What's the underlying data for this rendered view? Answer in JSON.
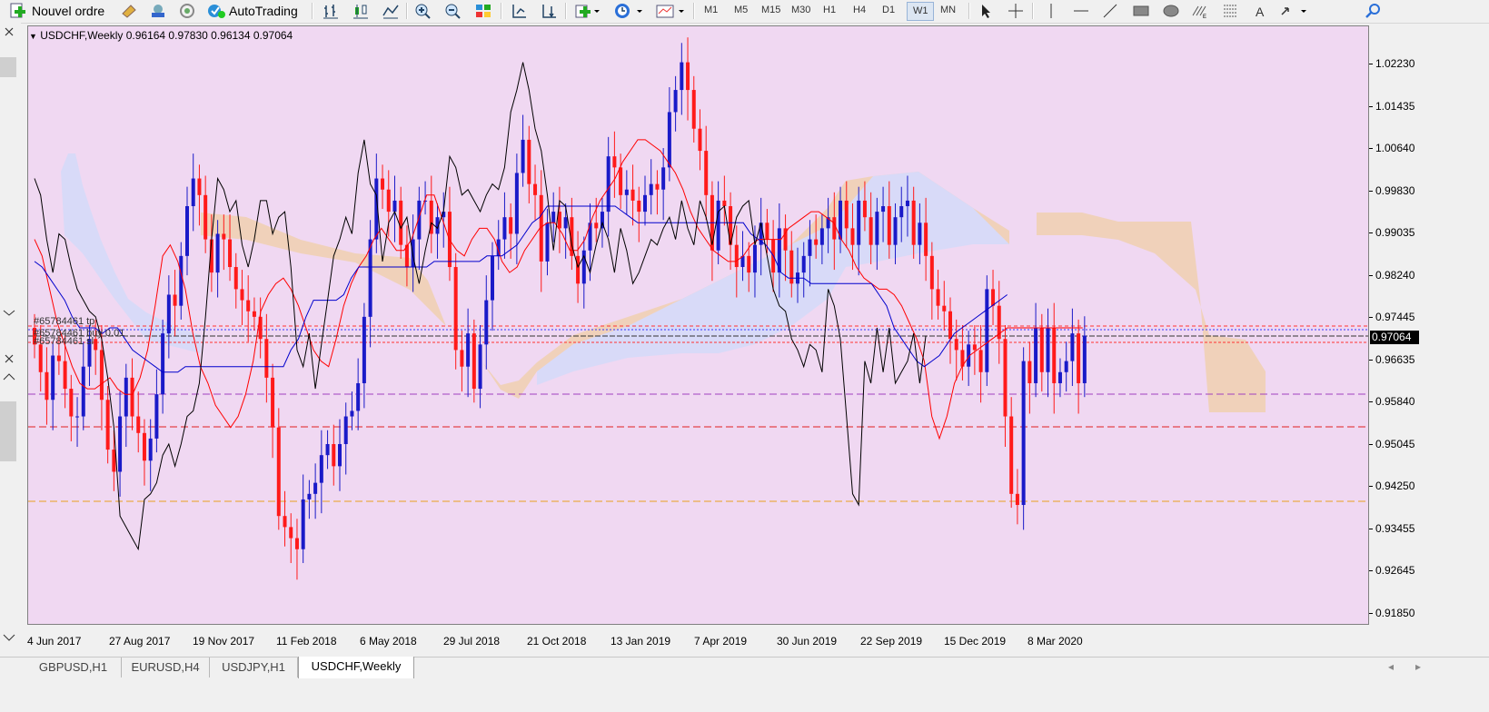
{
  "toolbar": {
    "new_order_label": "Nouvel ordre",
    "autotrading_label": "AutoTrading",
    "timeframes": [
      "M1",
      "M5",
      "M15",
      "M30",
      "H1",
      "H4",
      "D1",
      "W1",
      "MN"
    ],
    "active_timeframe": "W1",
    "icons": [
      "new-order-icon",
      "expert-icon",
      "market-watch-icon",
      "signals-icon",
      "autotrading-icon",
      "bar-chart-icon",
      "candlestick-icon",
      "line-chart-icon",
      "zoom-in-icon",
      "zoom-out-icon",
      "tile-windows-icon",
      "scroll-icon",
      "autoscroll-icon",
      "indicators-icon",
      "periods-icon",
      "templates-icon",
      "cursor-icon",
      "crosshair-icon",
      "vertical-line-icon",
      "horizontal-line-icon",
      "trendline-icon",
      "rectangle-icon",
      "ellipse-icon",
      "fibonacci-expansion-icon",
      "fibonacci-icon",
      "text-icon",
      "arrows-icon",
      "search-icon"
    ]
  },
  "chart": {
    "title": "USDCHF,Weekly  0.96164 0.97830 0.96134 0.97064",
    "current_price": "0.97064",
    "order_labels": [
      "#65784461 tp",
      "#65784461 buy 0.01",
      "#65784461 sl"
    ],
    "colors": {
      "background": "#f0d8f2",
      "bull_candle": "#1a1ac8",
      "bear_candle": "#ff1a1a",
      "tenkan": "#ff0000",
      "kijun": "#0000cc",
      "chikou": "#000000",
      "cloud_bull": "#d8daf8",
      "cloud_bear": "#f0d0b4"
    }
  },
  "price_axis": [
    "1.02230",
    "1.01435",
    "1.00640",
    "0.99830",
    "0.99035",
    "0.98240",
    "0.97445",
    "0.96635",
    "0.95840",
    "0.95045",
    "0.94250",
    "0.93455",
    "0.92645",
    "0.91850"
  ],
  "date_axis": [
    "4 Jun 2017",
    "27 Aug 2017",
    "19 Nov 2017",
    "11 Feb 2018",
    "6 May 2018",
    "29 Jul 2018",
    "21 Oct 2018",
    "13 Jan 2019",
    "7 Apr 2019",
    "30 Jun 2019",
    "22 Sep 2019",
    "15 Dec 2019",
    "8 Mar 2020"
  ],
  "tabs": [
    {
      "label": "GBPUSD,H1",
      "active": false
    },
    {
      "label": "EURUSD,H4",
      "active": false
    },
    {
      "label": "USDJPY,H1",
      "active": false
    },
    {
      "label": "USDCHF,Weekly",
      "active": true
    }
  ],
  "chart_data": {
    "type": "candlestick",
    "symbol": "USDCHF",
    "timeframe": "Weekly",
    "ylim": [
      0.9185,
      1.0265
    ],
    "open": [
      0.972,
      0.969,
      0.964,
      0.959,
      0.967,
      0.966,
      0.961,
      0.956,
      0.956,
      0.965,
      0.97,
      0.968,
      0.959,
      0.95,
      0.946,
      0.956,
      0.963,
      0.956,
      0.953,
      0.948,
      0.952,
      0.96,
      0.971,
      0.978,
      0.976,
      0.985,
      0.994,
      0.999,
      0.996,
      0.988,
      0.982,
      0.989,
      0.988,
      0.983,
      0.979,
      0.977,
      0.975,
      0.974,
      0.97,
      0.963,
      0.954,
      0.938,
      0.936,
      0.934,
      0.932,
      0.941,
      0.942,
      0.944,
      0.949,
      0.951,
      0.947,
      0.951,
      0.956,
      0.957,
      0.962,
      0.974,
      0.988,
      0.999,
      0.997,
      0.993,
      0.995,
      0.987,
      0.983,
      0.988,
      0.995,
      0.995,
      0.989,
      0.992,
      0.993,
      0.983,
      0.968,
      0.965,
      0.971,
      0.961,
      0.969,
      0.977,
      0.985,
      0.988,
      0.992,
      0.989,
      1.0,
      1.006,
      0.998,
      0.996,
      0.984,
      0.991,
      0.993,
      0.99,
      0.992,
      0.985,
      0.98,
      0.986,
      0.991,
      0.99,
      0.993,
      1.003,
      1.001,
      0.996,
      0.997,
      0.995,
      0.993,
      0.996,
      0.998,
      0.997,
      1.001,
      1.011,
      1.015,
      1.02,
      1.015,
      1.008,
      1.004,
      0.996,
      0.986,
      0.995,
      0.994,
      0.987,
      0.983,
      0.985,
      0.982,
      0.987,
      0.991,
      0.988,
      0.982,
      0.99,
      0.986,
      0.98,
      0.982,
      0.985,
      0.988,
      0.987,
      0.99,
      0.992,
      0.988,
      0.995,
      0.99,
      0.987,
      0.995,
      0.992,
      0.987,
      0.993,
      0.994,
      0.987,
      0.992,
      0.994,
      0.995,
      0.987,
      0.991,
      0.985,
      0.979,
      0.976,
      0.975,
      0.97,
      0.968,
      0.965,
      0.969,
      0.968,
      0.964,
      0.979,
      0.976,
      0.97,
      0.956,
      0.942,
      0.94,
      0.966,
      0.962,
      0.972,
      0.964,
      0.972,
      0.962,
      0.964,
      0.966,
      0.971,
      0.962
    ],
    "close": [
      0.969,
      0.964,
      0.959,
      0.967,
      0.966,
      0.961,
      0.956,
      0.956,
      0.965,
      0.97,
      0.968,
      0.959,
      0.95,
      0.946,
      0.956,
      0.963,
      0.956,
      0.953,
      0.948,
      0.952,
      0.96,
      0.971,
      0.978,
      0.976,
      0.985,
      0.994,
      0.999,
      0.996,
      0.988,
      0.982,
      0.989,
      0.988,
      0.983,
      0.979,
      0.977,
      0.975,
      0.974,
      0.97,
      0.963,
      0.954,
      0.938,
      0.936,
      0.934,
      0.932,
      0.941,
      0.942,
      0.944,
      0.949,
      0.951,
      0.947,
      0.951,
      0.956,
      0.957,
      0.962,
      0.974,
      0.988,
      0.999,
      0.997,
      0.993,
      0.995,
      0.987,
      0.983,
      0.988,
      0.995,
      0.995,
      0.989,
      0.992,
      0.993,
      0.983,
      0.968,
      0.965,
      0.971,
      0.961,
      0.969,
      0.977,
      0.985,
      0.988,
      0.992,
      0.989,
      1.0,
      1.006,
      0.998,
      0.996,
      0.984,
      0.991,
      0.993,
      0.99,
      0.992,
      0.985,
      0.98,
      0.986,
      0.991,
      0.99,
      0.993,
      1.003,
      1.001,
      0.996,
      0.997,
      0.995,
      0.993,
      0.996,
      0.998,
      0.997,
      1.001,
      1.011,
      1.015,
      1.02,
      1.015,
      1.008,
      1.004,
      0.996,
      0.986,
      0.995,
      0.994,
      0.987,
      0.983,
      0.985,
      0.982,
      0.987,
      0.991,
      0.988,
      0.982,
      0.99,
      0.986,
      0.98,
      0.982,
      0.985,
      0.988,
      0.987,
      0.99,
      0.992,
      0.988,
      0.995,
      0.99,
      0.987,
      0.995,
      0.992,
      0.987,
      0.993,
      0.994,
      0.987,
      0.992,
      0.994,
      0.995,
      0.987,
      0.991,
      0.985,
      0.979,
      0.976,
      0.975,
      0.97,
      0.968,
      0.965,
      0.969,
      0.968,
      0.964,
      0.979,
      0.976,
      0.97,
      0.956,
      0.942,
      0.94,
      0.966,
      0.962,
      0.972,
      0.964,
      0.972,
      0.962,
      0.964,
      0.966,
      0.971,
      0.962,
      0.9706
    ],
    "tenkan": [
      0.988,
      0.985,
      0.979,
      0.973,
      0.969,
      0.965,
      0.962,
      0.961,
      0.961,
      0.962,
      0.963,
      0.961,
      0.96,
      0.96,
      0.963,
      0.968,
      0.976,
      0.985,
      0.987,
      0.984,
      0.979,
      0.971,
      0.965,
      0.962,
      0.958,
      0.956,
      0.954,
      0.956,
      0.96,
      0.966,
      0.975,
      0.978,
      0.98,
      0.981,
      0.979,
      0.976,
      0.972,
      0.968,
      0.966,
      0.965,
      0.97,
      0.976,
      0.98,
      0.983,
      0.985,
      0.988,
      0.99,
      0.988,
      0.986,
      0.986,
      0.988,
      0.992,
      0.996,
      0.996,
      0.992,
      0.988,
      0.986,
      0.985,
      0.988,
      0.99,
      0.99,
      0.988,
      0.984,
      0.982,
      0.983,
      0.986,
      0.988,
      0.99,
      0.991,
      0.991,
      0.989,
      0.986,
      0.986,
      0.988,
      0.992,
      0.995,
      0.997,
      0.999,
      1.002,
      1.004,
      1.006,
      1.006,
      1.005,
      1.004,
      1.002,
      1.0,
      0.997,
      0.993,
      0.99,
      0.988,
      0.986,
      0.985,
      0.984,
      0.984,
      0.985,
      0.987,
      0.988,
      0.988,
      0.988,
      0.988,
      0.99,
      0.991,
      0.992,
      0.993,
      0.993,
      0.992,
      0.991,
      0.988,
      0.986,
      0.983,
      0.981,
      0.98,
      0.979,
      0.979,
      0.978,
      0.976,
      0.973,
      0.97,
      0.966,
      0.956,
      0.952,
      0.956,
      0.962,
      0.965,
      0.967,
      0.968,
      0.969,
      0.97,
      0.971,
      0.972,
      0.972,
      0.972,
      0.972,
      0.972,
      0.972,
      0.972,
      0.972,
      0.972,
      0.972,
      0.972
    ],
    "kijun": [
      0.984,
      0.983,
      0.981,
      0.979,
      0.977,
      0.974,
      0.972,
      0.972,
      0.972,
      0.971,
      0.972,
      0.972,
      0.97,
      0.968,
      0.967,
      0.966,
      0.965,
      0.964,
      0.964,
      0.964,
      0.965,
      0.965,
      0.965,
      0.965,
      0.965,
      0.965,
      0.965,
      0.965,
      0.965,
      0.965,
      0.965,
      0.965,
      0.965,
      0.965,
      0.968,
      0.97,
      0.974,
      0.977,
      0.977,
      0.977,
      0.977,
      0.978,
      0.981,
      0.983,
      0.983,
      0.983,
      0.983,
      0.983,
      0.983,
      0.983,
      0.983,
      0.983,
      0.983,
      0.984,
      0.984,
      0.984,
      0.984,
      0.984,
      0.984,
      0.984,
      0.985,
      0.985,
      0.985,
      0.986,
      0.987,
      0.989,
      0.991,
      0.992,
      0.994,
      0.994,
      0.994,
      0.994,
      0.994,
      0.994,
      0.994,
      0.994,
      0.994,
      0.994,
      0.993,
      0.992,
      0.991,
      0.991,
      0.991,
      0.991,
      0.991,
      0.991,
      0.991,
      0.991,
      0.991,
      0.991,
      0.991,
      0.991,
      0.991,
      0.991,
      0.991,
      0.989,
      0.988,
      0.987,
      0.985,
      0.982,
      0.981,
      0.981,
      0.981,
      0.98,
      0.98,
      0.98,
      0.98,
      0.98,
      0.98,
      0.98,
      0.98,
      0.98,
      0.978,
      0.976,
      0.972,
      0.97,
      0.968,
      0.966,
      0.965,
      0.966,
      0.967,
      0.969,
      0.971,
      0.972,
      0.973,
      0.974,
      0.975,
      0.976,
      0.977,
      0.978
    ]
  }
}
